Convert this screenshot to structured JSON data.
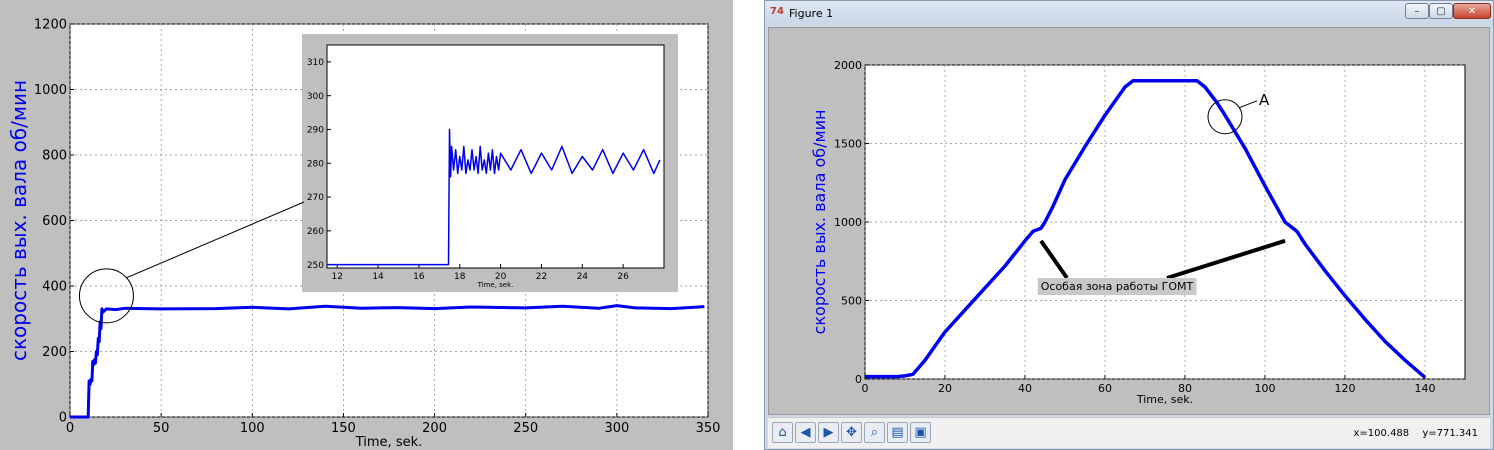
{
  "chart_data": [
    {
      "type": "line",
      "xlabel": "Time, sek.",
      "ylabel": "скорость вых. вала об/мин",
      "xlim": [
        0,
        350
      ],
      "ylim": [
        0,
        1200
      ],
      "x_ticks": [
        0,
        50,
        100,
        150,
        200,
        250,
        300,
        350
      ],
      "y_ticks": [
        0,
        200,
        400,
        600,
        800,
        1000,
        1200
      ],
      "grid": true,
      "color": "#0000ee",
      "series": [
        {
          "x": [
            0,
            10,
            10.5,
            11,
            11.5,
            12,
            12.5,
            13,
            13.5,
            14,
            14.5,
            15,
            15.5,
            16,
            16.5,
            17,
            17.5,
            18,
            19,
            20,
            25,
            30,
            50,
            80,
            100,
            120,
            140,
            160,
            180,
            200,
            220,
            250,
            270,
            290,
            300,
            310,
            330,
            345,
            348
          ],
          "y": [
            0,
            0,
            110,
            100,
            115,
            110,
            170,
            160,
            175,
            165,
            200,
            190,
            240,
            230,
            290,
            270,
            330,
            320,
            325,
            330,
            328,
            332,
            330,
            331,
            335,
            330,
            338,
            332,
            334,
            331,
            336,
            333,
            338,
            332,
            340,
            333,
            331,
            336,
            337
          ]
        }
      ],
      "annotations": [
        "zoom circle at (20, 370)"
      ],
      "inset": {
        "xlabel": "Time, sek.",
        "xlim": [
          11.5,
          28
        ],
        "ylim": [
          249,
          315
        ],
        "x_ticks": [
          12,
          14,
          16,
          18,
          20,
          22,
          24,
          26
        ],
        "y_ticks": [
          250,
          260,
          270,
          280,
          290,
          300,
          310
        ],
        "series": [
          {
            "x": [
              11.5,
              17.4,
              17.45,
              17.5,
              17.55,
              17.6,
              17.7,
              17.8,
              17.9,
              18.0,
              18.1,
              18.2,
              18.3,
              18.4,
              18.5,
              18.6,
              18.7,
              18.8,
              18.9,
              19.0,
              19.1,
              19.2,
              19.3,
              19.4,
              19.5,
              19.6,
              19.7,
              19.8,
              19.9,
              20.0,
              20.5,
              21.0,
              21.5,
              22.0,
              22.5,
              23.0,
              23.5,
              24.0,
              24.5,
              25.0,
              25.5,
              26.0,
              26.5,
              27.0,
              27.5,
              27.8
            ],
            "y": [
              250,
              250,
              250,
              290,
              276,
              285,
              278,
              284,
              277,
              282,
              278,
              285,
              277,
              281,
              278,
              284,
              278,
              282,
              277,
              285,
              278,
              281,
              277,
              283,
              278,
              284,
              277,
              282,
              278,
              283,
              278,
              284,
              277,
              283,
              278,
              285,
              277,
              282,
              278,
              284,
              277,
              283,
              278,
              284,
              277,
              281
            ]
          }
        ]
      }
    },
    {
      "type": "line",
      "window_title": "Figure 1",
      "xlabel": "Time, sek.",
      "ylabel": "скорость вых. вала об/мин",
      "xlim": [
        0,
        150
      ],
      "ylim": [
        0,
        2000
      ],
      "x_ticks": [
        0,
        20,
        40,
        60,
        80,
        100,
        120,
        140
      ],
      "y_ticks": [
        0,
        500,
        1000,
        1500,
        2000
      ],
      "grid": true,
      "color": "#0000ee",
      "series": [
        {
          "x": [
            0,
            8,
            10,
            12,
            15,
            20,
            25,
            30,
            35,
            40,
            42,
            43,
            44,
            45,
            47,
            50,
            55,
            60,
            65,
            67,
            70,
            75,
            80,
            83,
            85,
            88,
            90,
            95,
            100,
            105,
            107,
            108,
            110,
            115,
            120,
            125,
            130,
            135,
            140
          ],
          "y": [
            15,
            15,
            20,
            30,
            120,
            300,
            440,
            580,
            720,
            880,
            940,
            950,
            960,
            1000,
            1100,
            1270,
            1480,
            1680,
            1860,
            1900,
            1900,
            1900,
            1900,
            1900,
            1860,
            1760,
            1680,
            1470,
            1230,
            1000,
            960,
            940,
            860,
            690,
            530,
            380,
            240,
            120,
            10
          ]
        }
      ],
      "annotations": [
        {
          "text": "A",
          "near": [
            90,
            1670
          ]
        },
        {
          "text": "Особая зона работы ГОМТ",
          "pointers": [
            [
              44,
              880
            ],
            [
              105,
              880
            ]
          ]
        }
      ]
    }
  ],
  "figure_window": {
    "title": "Figure 1",
    "icon": "matplotlib-icon",
    "controls": [
      "minimize",
      "maximize",
      "close"
    ]
  },
  "toolbar": {
    "buttons": [
      "home-icon",
      "back-icon",
      "forward-icon",
      "pan-icon",
      "zoom-icon",
      "configure-icon",
      "save-icon"
    ],
    "x_readout": "x=100.488",
    "y_readout": "y=771.341"
  }
}
